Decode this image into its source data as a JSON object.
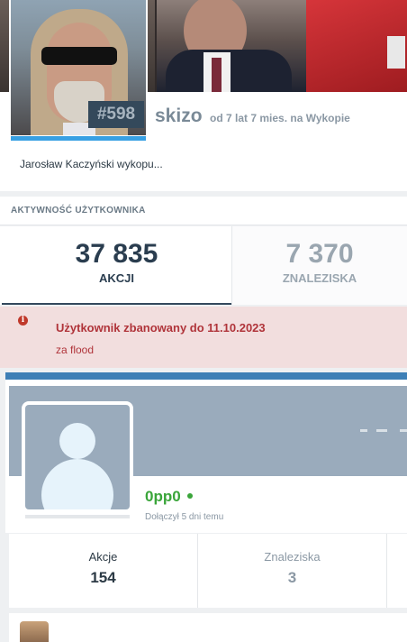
{
  "profile": {
    "rank": "#598",
    "username": "skizo",
    "member_since": "od 7 lat 7 mies. na Wykopie",
    "about": "Jarosław Kaczyński wykopu..."
  },
  "activity": {
    "title": "AKTYWNOŚĆ UŻYTKOWNIKA",
    "actions": {
      "value": "37 835",
      "label": "AKCJI"
    },
    "found": {
      "value": "7 370",
      "label": "ZNALEZISKA"
    }
  },
  "ban": {
    "icon": "info-icon",
    "icon_glyph": "i",
    "title": "Użytkownik zbanowany do 11.10.2023",
    "reason": "za flood"
  },
  "card2": {
    "username": "0pp0",
    "status": "online",
    "joined": "Dołączył 5 dni temu",
    "stats": [
      {
        "label": "Akcje",
        "value": "154"
      },
      {
        "label": "Znaleziska",
        "value": "3"
      }
    ]
  },
  "colors": {
    "accent_blue": "#38a0e3",
    "ban_background": "#f2dede",
    "ban_text": "#b0343a",
    "online_green": "#3aa53a",
    "dark_navy": "#2a3d4f"
  }
}
